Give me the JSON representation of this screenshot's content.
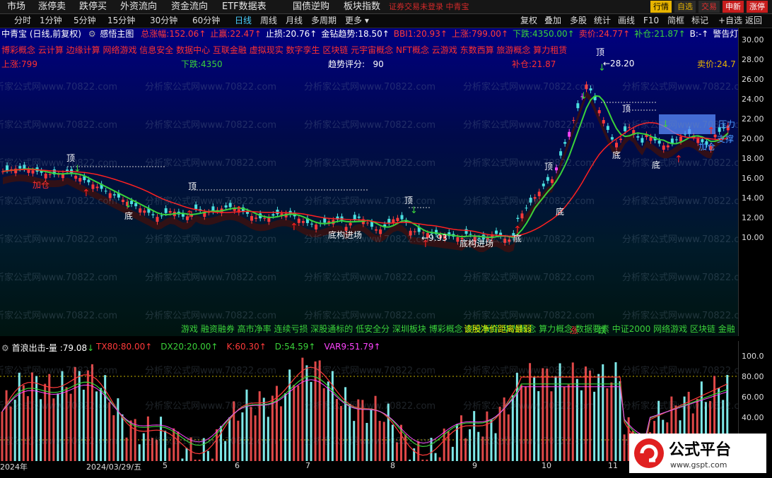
{
  "topbar": {
    "menu": [
      "市场",
      "涨停卖",
      "跌停买",
      "外资流向",
      "资金流向",
      "ETF数据表",
      "国债逆购",
      "板块指数"
    ],
    "warning": "证券交易未登录  中青宝",
    "right_buttons": [
      {
        "label": "行情",
        "bg": "#e8b400",
        "fg": "#000"
      },
      {
        "label": "自选",
        "bg": "#2a2a2a",
        "fg": "#e8b400"
      },
      {
        "label": "交易",
        "bg": "#2a2a2a",
        "fg": "#e03030"
      },
      {
        "label": "申新",
        "bg": "#c81e1e",
        "fg": "#fff"
      },
      {
        "label": "涨停",
        "bg": "#c81e1e",
        "fg": "#fff"
      }
    ]
  },
  "periods": [
    "分时",
    "1分钟",
    "5分钟",
    "15分钟",
    "30分钟",
    "60分钟",
    "日线",
    "周线",
    "月线",
    "多周期",
    "更多"
  ],
  "active_period": "日线",
  "toolbar_right": [
    "复权",
    "叠加",
    "多股",
    "统计",
    "画线",
    "F10",
    "简框",
    "标记",
    "+自选",
    "返回"
  ],
  "stock": {
    "title": "中青宝 (日线,前复权)",
    "indicator": "感悟主图",
    "items": [
      {
        "label": "总涨幅:",
        "value": "152.06",
        "color": "#ff3a3a"
      },
      {
        "label": "止赢:",
        "value": "22.47",
        "color": "#ff3a3a"
      },
      {
        "label": "止损:",
        "value": "20.76",
        "color": "#ffffff"
      },
      {
        "label": "金钻趋势:",
        "value": "18.50",
        "color": "#ffffff"
      },
      {
        "label": "BBI1:",
        "value": "20.93",
        "color": "#ff3a3a"
      },
      {
        "label": "上涨:",
        "value": "799.00",
        "color": "#ff3a3a"
      },
      {
        "label": "下跌:",
        "value": "4350.00",
        "color": "#3ad23a"
      },
      {
        "label": "卖价:",
        "value": "24.77",
        "color": "#ff3a3a"
      },
      {
        "label": "补仓:",
        "value": "21.87",
        "color": "#3ad23a"
      },
      {
        "label": "B:",
        "value": "-",
        "color": "#ffffff"
      },
      {
        "label": "警告灯:",
        "value": "-",
        "color": "#ffffff"
      }
    ]
  },
  "concepts_top": "博彩概念 云计算 边缘计算 网络游戏 信息安全 数据中心 互联金融 虚拟现实 数字孪生 区块链 元宇宙概念 NFT概念 云游戏 东数西算 旅游概念 算力租赁",
  "overlay": {
    "rise": "上涨:799",
    "fall": "下跌:4350",
    "score_label": "趋势评分:",
    "score": "90",
    "bucang": "补仓:21.87",
    "maijia": "卖价:24.7"
  },
  "concepts_bottom": "游戏 融资融券 高市净率 连续亏损 深股通标的 低安全分 深圳板块 博彩概念 创业板综 华为概念 算力概念 数据要素 中证2000 网络游戏 区块链 金融 虚拟现实 数字",
  "ticker_overlap": "该股净价距离最弱",
  "tags": {
    "ding": "顶",
    "di": "底",
    "jiacang": "加仓",
    "yali": "压力",
    "zhicheng": "支撑",
    "dijiu": "底构进场",
    "up": "涨",
    "down": "跌"
  },
  "price_labels": {
    "high": "28.20",
    "low": "9.93"
  },
  "yaxis": [
    "30.00",
    "28.00",
    "26.00",
    "24.00",
    "22.00",
    "20.00",
    "18.00",
    "16.00",
    "14.00",
    "12.00",
    "10.00"
  ],
  "lower_header": {
    "title": "首浪出击-量 :",
    "value": "79.08",
    "items": [
      {
        "label": "TX80:",
        "value": "80.00",
        "color": "#ff3a3a"
      },
      {
        "label": "DX20:",
        "value": "20.00",
        "color": "#3ad23a"
      },
      {
        "label": "K:",
        "value": "60.30",
        "color": "#ff3a3a"
      },
      {
        "label": "D:",
        "value": "54.59",
        "color": "#3ad23a"
      },
      {
        "label": "VAR9:",
        "value": "51.79",
        "color": "#ff44ff"
      }
    ]
  },
  "yaxis2": [
    "100.0",
    "80.00",
    "60.00",
    "40.00"
  ],
  "xaxis": [
    "2024年",
    "2024/03/29/五",
    "5",
    "6",
    "7",
    "8",
    "9",
    "10",
    "11"
  ],
  "watermark": [
    "分析家公式网www.70822.com"
  ],
  "logo": {
    "text": "公式平台",
    "url": "www.gspt.com"
  },
  "colors": {
    "up": "#ff3a3a",
    "down": "#3ad23a",
    "bg_top": "#000080"
  }
}
